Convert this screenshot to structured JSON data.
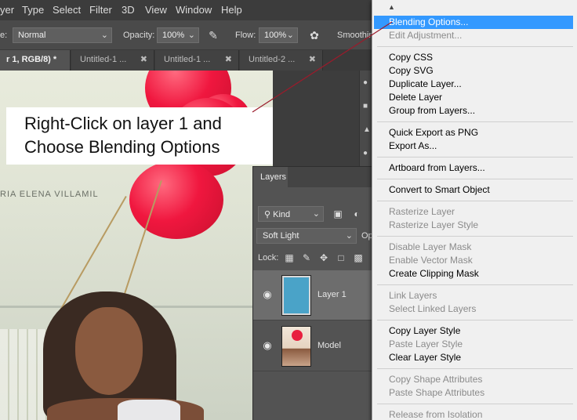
{
  "menubar": {
    "items": [
      "yer",
      "Type",
      "Select",
      "Filter",
      "3D",
      "View",
      "Window",
      "Help"
    ]
  },
  "options_bar": {
    "mode_label": "e:",
    "mode_value": "Normal",
    "opacity_label": "Opacity:",
    "opacity_value": "100%",
    "flow_label": "Flow:",
    "flow_value": "100%",
    "smoothing_label": "Smoothin"
  },
  "tabs": [
    {
      "label": "r 1, RGB/8) *",
      "active": true
    },
    {
      "label": "Untitled-1 ...",
      "active": false
    },
    {
      "label": "Untitled-1 ...",
      "active": false
    },
    {
      "label": "Untitled-2 ...",
      "active": false
    }
  ],
  "canvas": {
    "sign_text": "RIA ELENA VILLAMIL"
  },
  "annotation": {
    "line1": "Right-Click on layer 1 and",
    "line2": "Choose Blending Options",
    "arrow_color": "#9b1b2b"
  },
  "layers_panel": {
    "tab_label": "Layers",
    "filter_value": "Kind",
    "blend_value": "Soft Light",
    "opacity_short": "Op",
    "lock_label": "Lock:",
    "layers": [
      {
        "name": "Layer 1",
        "selected": true,
        "thumb_color": "#4aa3c8"
      },
      {
        "name": "Model",
        "selected": false
      }
    ]
  },
  "context_menu": {
    "groups": [
      [
        {
          "label": "Blending Options...",
          "enabled": true,
          "highlighted": true
        },
        {
          "label": "Edit Adjustment...",
          "enabled": false
        }
      ],
      [
        {
          "label": "Copy CSS",
          "enabled": true
        },
        {
          "label": "Copy SVG",
          "enabled": true
        },
        {
          "label": "Duplicate Layer...",
          "enabled": true
        },
        {
          "label": "Delete Layer",
          "enabled": true
        },
        {
          "label": "Group from Layers...",
          "enabled": true
        }
      ],
      [
        {
          "label": "Quick Export as PNG",
          "enabled": true
        },
        {
          "label": "Export As...",
          "enabled": true
        }
      ],
      [
        {
          "label": "Artboard from Layers...",
          "enabled": true
        }
      ],
      [
        {
          "label": "Convert to Smart Object",
          "enabled": true
        }
      ],
      [
        {
          "label": "Rasterize Layer",
          "enabled": false
        },
        {
          "label": "Rasterize Layer Style",
          "enabled": false
        }
      ],
      [
        {
          "label": "Disable Layer Mask",
          "enabled": false
        },
        {
          "label": "Enable Vector Mask",
          "enabled": false
        },
        {
          "label": "Create Clipping Mask",
          "enabled": true
        }
      ],
      [
        {
          "label": "Link Layers",
          "enabled": false
        },
        {
          "label": "Select Linked Layers",
          "enabled": false
        }
      ],
      [
        {
          "label": "Copy Layer Style",
          "enabled": true
        },
        {
          "label": "Paste Layer Style",
          "enabled": false
        },
        {
          "label": "Clear Layer Style",
          "enabled": true
        }
      ],
      [
        {
          "label": "Copy Shape Attributes",
          "enabled": false
        },
        {
          "label": "Paste Shape Attributes",
          "enabled": false
        }
      ],
      [
        {
          "label": "Release from Isolation",
          "enabled": false
        }
      ]
    ],
    "highlight_color": "#3399ff"
  }
}
